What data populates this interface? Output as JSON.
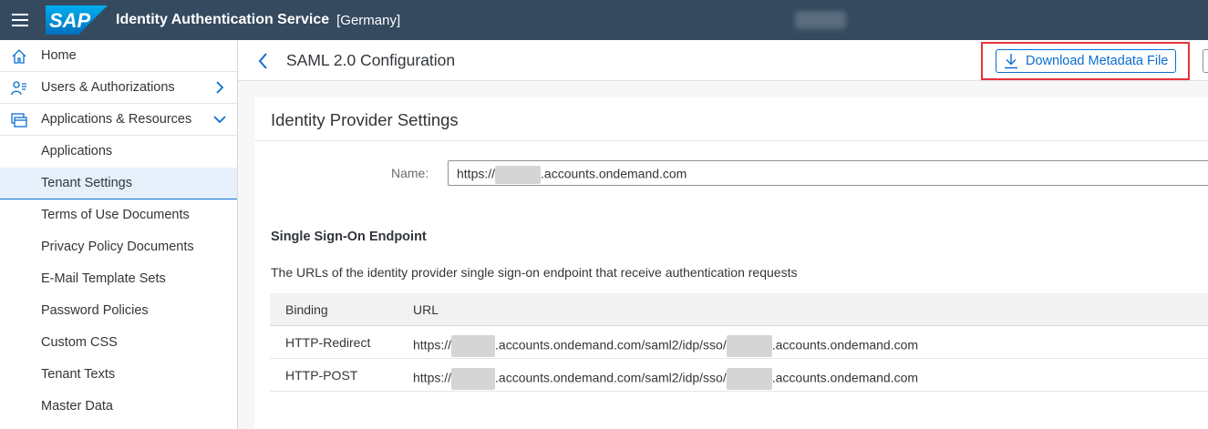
{
  "shell": {
    "brand": "SAP",
    "app_title": "Identity Authentication Service",
    "tenant": "[Germany]"
  },
  "sidebar": {
    "items": [
      {
        "label": "Home",
        "icon": "home-icon"
      },
      {
        "label": "Users & Authorizations",
        "icon": "users-icon",
        "expandable": true,
        "expanded": false
      },
      {
        "label": "Applications & Resources",
        "icon": "applications-icon",
        "expandable": true,
        "expanded": true
      }
    ],
    "subitems": [
      {
        "label": "Applications"
      },
      {
        "label": "Tenant Settings",
        "selected": true
      },
      {
        "label": "Terms of Use Documents"
      },
      {
        "label": "Privacy Policy Documents"
      },
      {
        "label": "E-Mail Template Sets"
      },
      {
        "label": "Password Policies"
      },
      {
        "label": "Custom CSS"
      },
      {
        "label": "Tenant Texts"
      },
      {
        "label": "Master Data"
      }
    ]
  },
  "header": {
    "title": "SAML 2.0 Configuration",
    "download_label": "Download Metadata File"
  },
  "panel": {
    "title": "Identity Provider Settings",
    "name_label": "Name:",
    "name_prefix": "https://",
    "name_suffix": ".accounts.ondemand.com"
  },
  "sso": {
    "heading": "Single Sign-On Endpoint",
    "description": "The URLs of the identity provider single sign-on endpoint that receive authentication requests",
    "columns": [
      "Binding",
      "URL"
    ],
    "rows": [
      {
        "binding": "HTTP-Redirect",
        "url_prefix": "https://",
        "url_mid": ".accounts.ondemand.com/saml2/idp/sso/",
        "url_suffix": ".accounts.ondemand.com"
      },
      {
        "binding": "HTTP-POST",
        "url_prefix": "https://",
        "url_mid": ".accounts.ondemand.com/saml2/idp/sso/",
        "url_suffix": ".accounts.ondemand.com"
      }
    ]
  },
  "colors": {
    "shell": "#354a5f",
    "accent": "#0a6ed1",
    "highlight": "#e3343a",
    "selected_bg": "#e5f0fa"
  }
}
